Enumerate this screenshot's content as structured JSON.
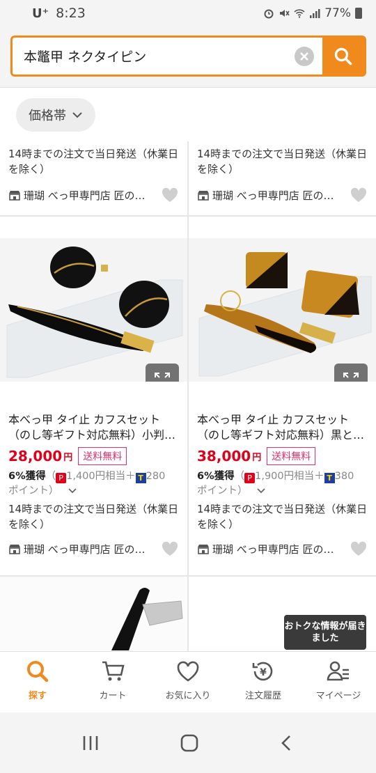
{
  "status_bar": {
    "carrier": "U⁺",
    "time": "8:23",
    "battery": "77%"
  },
  "search": {
    "query": "本鼈甲 ネクタイピン"
  },
  "filter": {
    "chip_label": "価格帯"
  },
  "top_row": [
    {
      "shipping": "14時までの注文で当日発送（休業日を除く）",
      "store": "珊瑚 べっ甲専門店 匠の…"
    },
    {
      "shipping": "14時までの注文で当日発送（休業日を除く）",
      "store": "珊瑚 べっ甲専門店 匠の…"
    }
  ],
  "products": [
    {
      "title": "本べっ甲 タイ止 カフスセット（のし等ギフト対応無料）小判…",
      "price": "28,000",
      "yen": "円",
      "free_shipping": "送料無料",
      "points_rate": "6%獲得",
      "points_detail_a": "（",
      "points_paypay": "1,400円相当＋",
      "points_t": "280",
      "points_detail_b": "ポイント）",
      "shipping": "14時までの注文で当日発送（休業日を除く）",
      "store": "珊瑚 べっ甲専門店 匠の…"
    },
    {
      "title": "本べっ甲 タイ止 カフスセット（のし等ギフト対応無料）黒と…",
      "price": "38,000",
      "yen": "円",
      "free_shipping": "送料無料",
      "points_rate": "6%獲得",
      "points_detail_a": "（",
      "points_paypay": "1,900円相当＋",
      "points_t": "380",
      "points_detail_b": "ポイント）",
      "shipping": "14時までの注文で当日発送（休業日を除く）",
      "store": "珊瑚 べっ甲専門店 匠の…"
    }
  ],
  "toast": {
    "text": "おトクな情報が届きました"
  },
  "bottom_nav": [
    {
      "label": "探す",
      "icon": "search-icon"
    },
    {
      "label": "カート",
      "icon": "cart-icon"
    },
    {
      "label": "お気に入り",
      "icon": "heart-icon"
    },
    {
      "label": "注文履歴",
      "icon": "order-history-icon"
    },
    {
      "label": "マイページ",
      "icon": "mypage-icon"
    }
  ],
  "colors": {
    "accent": "#f08a1c",
    "price": "#e0001a",
    "free_shipping": "#e0306a"
  }
}
